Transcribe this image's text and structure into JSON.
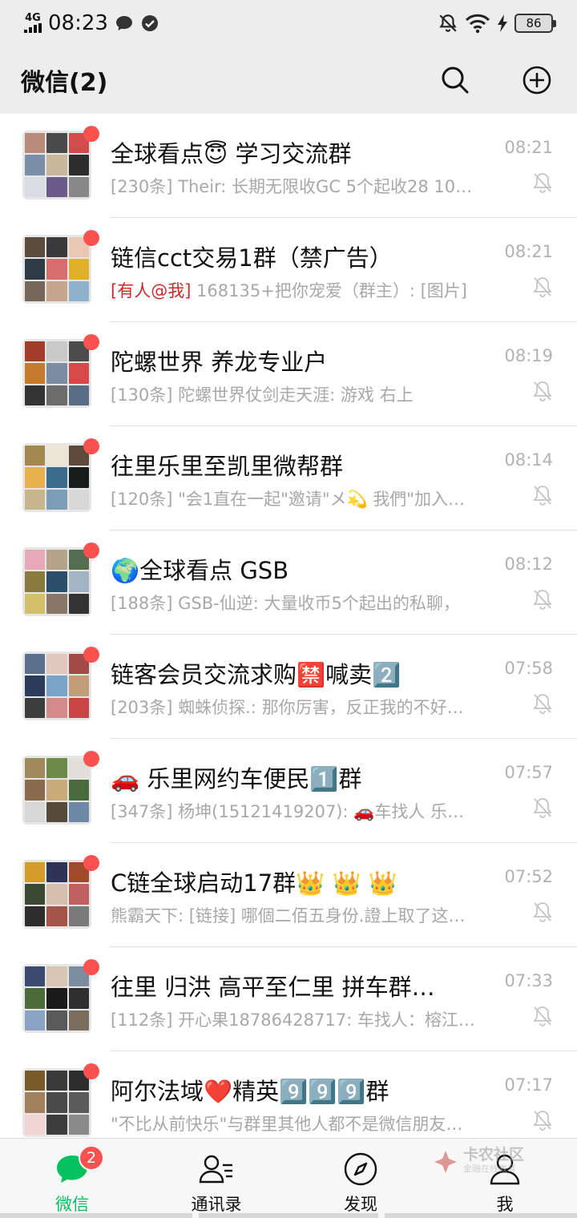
{
  "status_bar": {
    "network": "4G",
    "time": "08:23",
    "battery": "86"
  },
  "header": {
    "title": "微信(2)"
  },
  "chats": [
    {
      "name": "全球看点😇 学习交流群",
      "time": "08:21",
      "mention": "",
      "preview": "[230条] Their: 长期无限收GC  5个起收28 10…"
    },
    {
      "name": "链信cct交易1群（禁广告）",
      "time": "08:21",
      "mention": "[有人@我]",
      "preview": " 168135+把你宠爱（群主）: [图片]"
    },
    {
      "name": "陀螺世界 养龙专业户",
      "time": "08:19",
      "mention": "",
      "preview": "[130条] 陀螺世界仗剑走天涯: 游戏 右上"
    },
    {
      "name": "往里乐里至凯里微帮群",
      "time": "08:14",
      "mention": "",
      "preview": "[120条] \"会1直在一起\"邀请\"メ💫 我們\"加入…"
    },
    {
      "name": "🌍全球看点  GSB",
      "time": "08:12",
      "mention": "",
      "preview": "[188条] GSB-仙逆: 大量收币5个起出的私聊，"
    },
    {
      "name": "链客会员交流求购🈲喊卖2️⃣",
      "time": "07:58",
      "mention": "",
      "preview": "[203条] 蜘蛛侦探.: 那你厉害，反正我的不好…"
    },
    {
      "name": "🚗 乐里网约车便民1️⃣群",
      "time": "07:57",
      "mention": "",
      "preview": "[347条] 杨坤(15121419207): 🚗车找人   乐…"
    },
    {
      "name": "C链全球启动17群👑 👑 👑",
      "time": "07:52",
      "mention": "",
      "preview": "熊霸天下: [链接] 哪個二佰五身份.證上取了这…"
    },
    {
      "name": "往里  归洪 高平至仁里 拼车群…",
      "time": "07:33",
      "mention": "",
      "preview": "[112条] 开心果18786428717: 车找人：榕江…"
    },
    {
      "name": "阿尔法域❤️精英9️⃣9️⃣9️⃣群",
      "time": "07:17",
      "mention": "",
      "preview": "\"不比从前快乐\"与群里其他人都不是微信朋友…"
    }
  ],
  "tabs": [
    {
      "label": "微信",
      "icon": "chat-bubble-icon",
      "badge": "2"
    },
    {
      "label": "通讯录",
      "icon": "contacts-icon"
    },
    {
      "label": "发现",
      "icon": "compass-icon"
    },
    {
      "label": "我",
      "icon": "person-icon"
    }
  ],
  "watermark": {
    "main": "卡农社区",
    "sub": "金融在线教育"
  },
  "colors": {
    "accent": "#07c160",
    "badge": "#fa5151",
    "mention": "#c72b2b"
  }
}
